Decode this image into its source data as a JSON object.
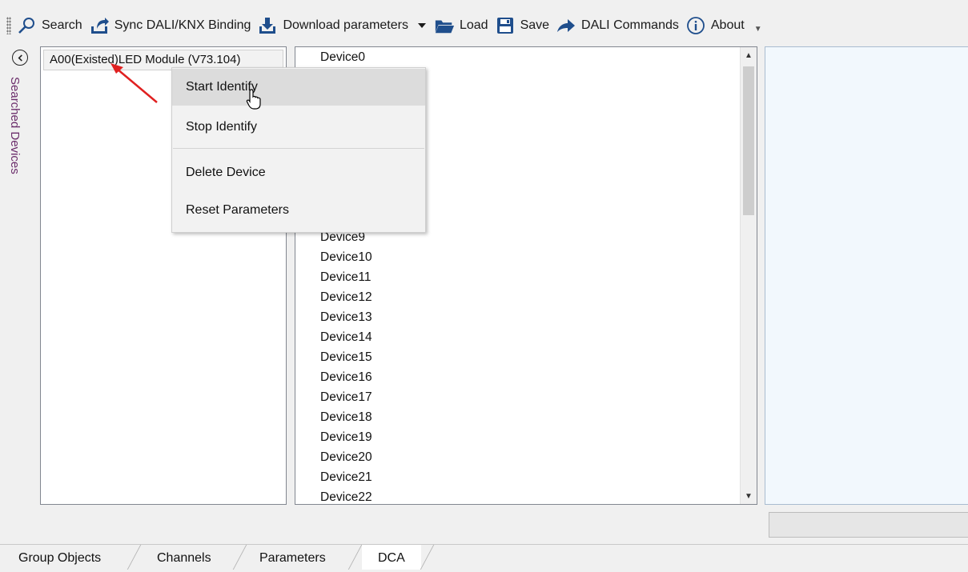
{
  "toolbar": {
    "buttons": [
      {
        "label": "Search",
        "icon": "search-icon"
      },
      {
        "label": "Sync DALI/KNX Binding",
        "icon": "sync-icon"
      },
      {
        "label": "Download parameters",
        "icon": "download-icon"
      },
      {
        "label": "Load",
        "icon": "folder-icon"
      },
      {
        "label": "Save",
        "icon": "save-icon"
      },
      {
        "label": "DALI Commands",
        "icon": "arrow-icon"
      },
      {
        "label": "About",
        "icon": "info-icon"
      }
    ]
  },
  "side_panel": {
    "label": "Searched Devices"
  },
  "searched_devices": {
    "items": [
      "A00(Existed)LED Module (V73.104)"
    ]
  },
  "device_list": {
    "items": [
      "Device0",
      "Device9",
      "Device10",
      "Device11",
      "Device12",
      "Device13",
      "Device14",
      "Device15",
      "Device16",
      "Device17",
      "Device18",
      "Device19",
      "Device20",
      "Device21",
      "Device22"
    ]
  },
  "context_menu": {
    "items": [
      "Start Identify",
      "Stop Identify",
      "Delete Device",
      "Reset Parameters"
    ]
  },
  "tabs": [
    "Group Objects",
    "Channels",
    "Parameters",
    "DCA"
  ],
  "colors": {
    "accent": "#1f4e8c",
    "side_label": "#6b2d6b",
    "arrow": "#e02020"
  }
}
